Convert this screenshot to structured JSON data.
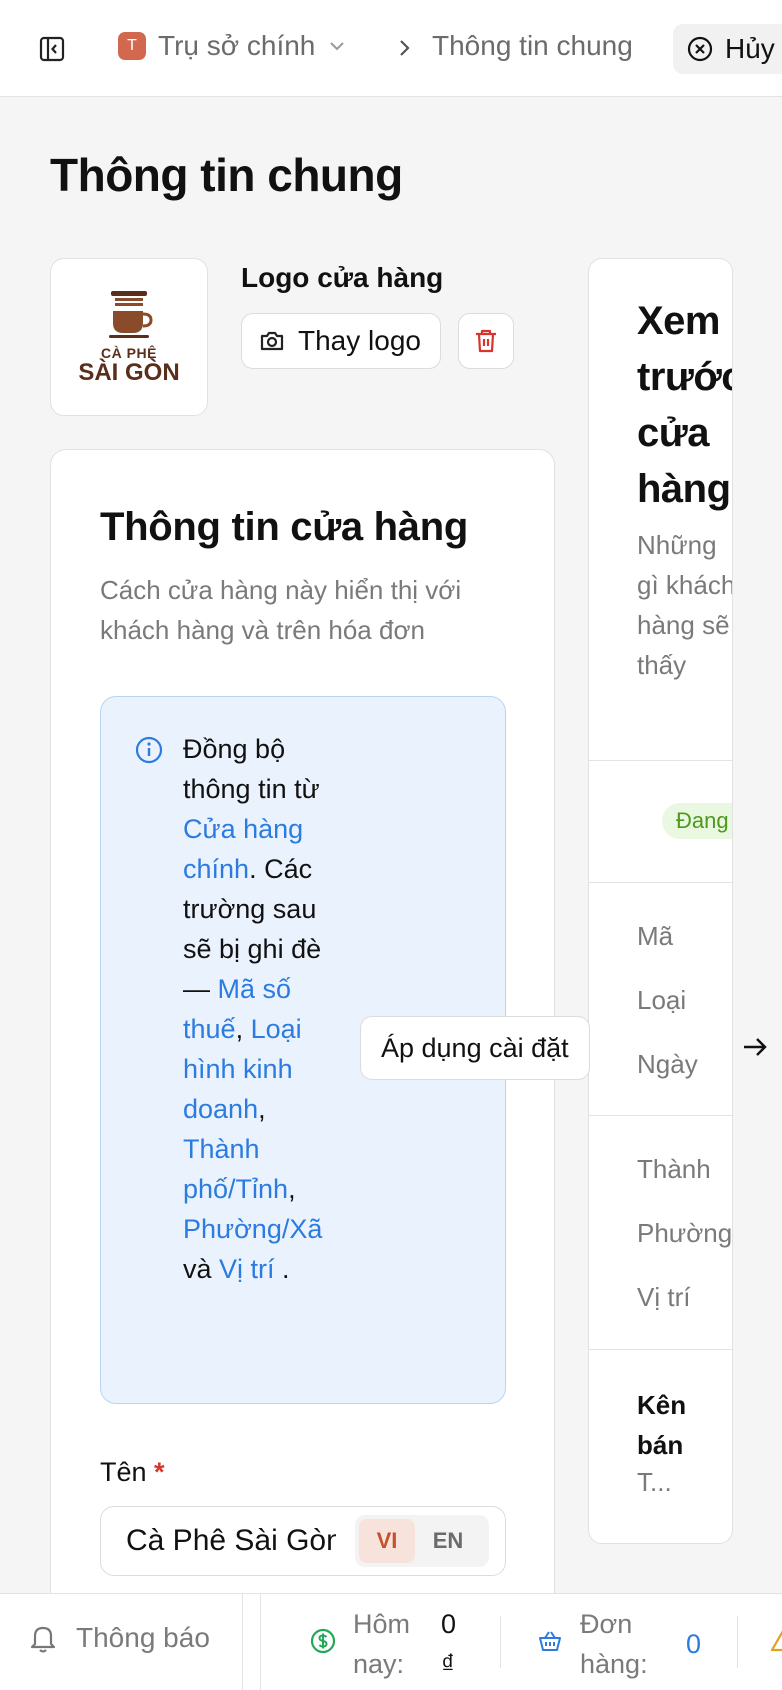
{
  "topbar": {
    "store_badge": "T",
    "store_name": "Trụ sở chính",
    "breadcrumb_current": "Thông tin chung",
    "cancel_label": "Hủy"
  },
  "page": {
    "title": "Thông tin chung"
  },
  "logo": {
    "line1": "CÀ PHÊ",
    "line2": "SÀI GÒN",
    "label": "Logo cửa hàng",
    "change_label": "Thay logo"
  },
  "store_info": {
    "title": "Thông tin cửa hàng",
    "subtitle": "Cách cửa hàng này hiển thị với khách hàng và trên hóa đơn",
    "sync": {
      "t1": "Đồng bộ thông tin từ ",
      "link_main_store": "Cửa hàng chính",
      "t2": ". Các trường sau sẽ bị ghi đè — ",
      "f_tax": "Mã số thuế",
      "f_type": "Loại hình kinh doanh",
      "f_city": "Thành phố/Tỉnh",
      "f_ward": "Phường/Xã",
      "t_and": " và ",
      "f_location": "Vị trí",
      "t_end": " ."
    },
    "name_label": "Tên",
    "name_required": "*",
    "name_value": "Cà Phê Sài Gòn",
    "lang_vi": "VI",
    "lang_en": "EN"
  },
  "apply_button": "Áp dụng cài đặt",
  "preview": {
    "title": "Xem trước cửa hàng",
    "subtitle": "Những gì khách hàng sẽ thấy",
    "status": "Đang hoạt động",
    "row_tax": "Mã",
    "row_type": "Loại",
    "row_date": "Ngày",
    "row_city": "Thành",
    "row_ward": "Phường",
    "row_location": "Vị trí",
    "channel_title": "Kênh bán",
    "channel_value": "T..."
  },
  "bottombar": {
    "notif_label": "Thông báo",
    "today_label": "Hôm nay:",
    "today_value": "0 ₫",
    "orders_label": "Đơn hàng:",
    "orders_value": "0"
  }
}
